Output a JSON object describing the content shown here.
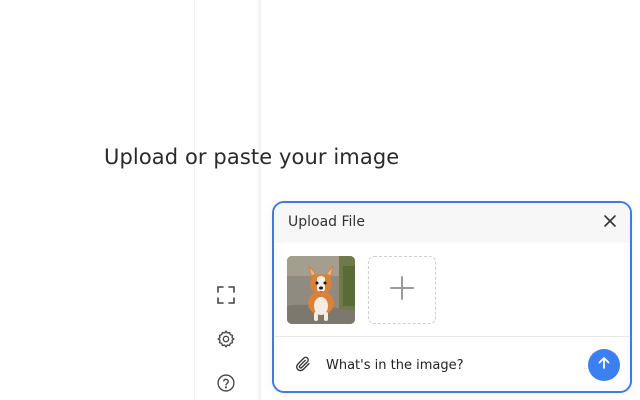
{
  "main": {
    "headline": "Upload or paste your image"
  },
  "rail": {
    "icons": [
      "fullscreen-icon",
      "gear-icon",
      "help-icon"
    ]
  },
  "upload_panel": {
    "title": "Upload File",
    "close_icon": "close-icon",
    "add_icon": "plus-icon",
    "attach_icon": "paperclip-icon",
    "send_icon": "arrow-up-icon",
    "input_value": "What's in the image?",
    "accent_color": "#3d7be0",
    "send_color": "#3b7ff2"
  }
}
